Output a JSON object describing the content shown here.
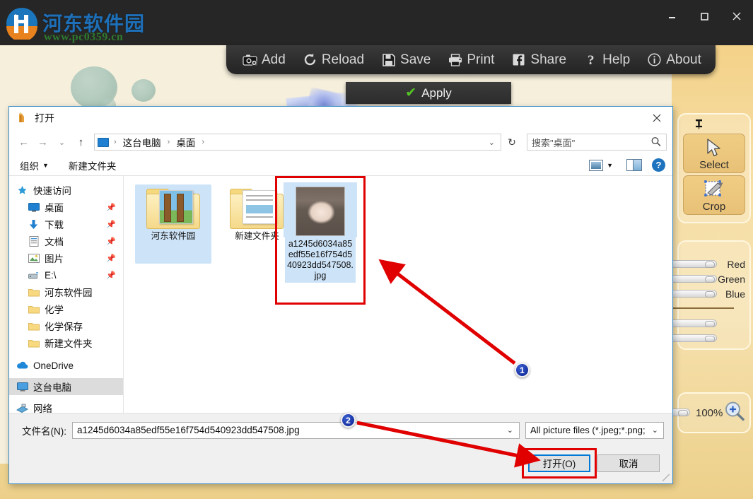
{
  "window": {
    "watermark_title": "河东软件园",
    "watermark_url": "www.pc0359.cn",
    "minimize": "–",
    "maximize": "❐",
    "close": "✕"
  },
  "toolbar": {
    "items": [
      {
        "label": "Add",
        "icon": "camera-add-icon"
      },
      {
        "label": "Reload",
        "icon": "reload-icon"
      },
      {
        "label": "Save",
        "icon": "floppy-save-icon"
      },
      {
        "label": "Print",
        "icon": "printer-icon"
      },
      {
        "label": "Share",
        "icon": "facebook-share-icon"
      },
      {
        "label": "Help",
        "icon": "question-help-icon"
      },
      {
        "label": "About",
        "icon": "info-about-icon"
      }
    ]
  },
  "apply_bar": {
    "label": "Apply",
    "icon": "green-check-icon"
  },
  "right_panel": {
    "pin_icon": "pin-icon",
    "tools": [
      {
        "label": "Select",
        "icon": "cursor-arrow-icon"
      },
      {
        "label": "Crop",
        "icon": "crop-icon"
      }
    ],
    "sliders": [
      {
        "label": "Red"
      },
      {
        "label": "Green"
      },
      {
        "label": "Blue"
      }
    ],
    "zoom": {
      "value": "100%",
      "icon": "magnifier-plus-icon"
    }
  },
  "dialog": {
    "title": "打开",
    "title_icon": "app-icon",
    "close_label": "✕",
    "nav": {
      "back": "←",
      "forward": "→",
      "recent": "⌄",
      "up": "↑",
      "refresh": "↻",
      "breadcrumb": [
        "这台电脑",
        "桌面"
      ],
      "breadcrumb_sep": "›",
      "breadcrumb_caret": "⌄"
    },
    "search": {
      "placeholder": "搜索\"桌面\"",
      "icon": "search-icon"
    },
    "commandbar": {
      "organize": "组织",
      "organize_caret": "▼",
      "new_folder": "新建文件夹",
      "view_icon": "view-layout-icon",
      "view_caret": "▼",
      "preview_icon": "preview-pane-icon",
      "help_icon": "help-icon",
      "help_label": "?"
    },
    "nav_pane": [
      {
        "label": "快速访问",
        "icon": "star-pin-icon",
        "group": true,
        "pinned": false,
        "selected": false
      },
      {
        "label": "桌面",
        "icon": "desktop-icon",
        "indent": true,
        "pinned": true,
        "selected": false
      },
      {
        "label": "下载",
        "icon": "download-icon",
        "indent": true,
        "pinned": true,
        "selected": false
      },
      {
        "label": "文档",
        "icon": "documents-icon",
        "indent": true,
        "pinned": true,
        "selected": false
      },
      {
        "label": "图片",
        "icon": "pictures-icon",
        "indent": true,
        "pinned": true,
        "selected": false
      },
      {
        "label": "E:\\",
        "icon": "drive-icon",
        "indent": true,
        "pinned": true,
        "selected": false
      },
      {
        "label": "河东软件园",
        "icon": "folder-icon",
        "indent": true,
        "pinned": false,
        "selected": false
      },
      {
        "label": "化学",
        "icon": "folder-icon",
        "indent": true,
        "pinned": false,
        "selected": false
      },
      {
        "label": "化学保存",
        "icon": "folder-icon",
        "indent": true,
        "pinned": false,
        "selected": false
      },
      {
        "label": "新建文件夹",
        "icon": "folder-icon",
        "indent": true,
        "pinned": false,
        "selected": false
      },
      {
        "label": "OneDrive",
        "icon": "cloud-icon",
        "group": true,
        "pinned": false,
        "selected": false
      },
      {
        "label": "这台电脑",
        "icon": "computer-icon",
        "group": true,
        "pinned": false,
        "selected": true
      },
      {
        "label": "网络",
        "icon": "network-icon",
        "group": true,
        "pinned": false,
        "selected": false
      }
    ],
    "files": [
      {
        "name": "河东软件园",
        "type": "folder",
        "selected": false
      },
      {
        "name": "新建文件夹",
        "type": "folder",
        "selected": false
      },
      {
        "name": "a1245d6034a85edf55e16f754d540923dd547508.jpg",
        "type": "image",
        "selected": true
      }
    ],
    "filename": {
      "label": "文件名(N):",
      "value": "a1245d6034a85edf55e16f754d540923dd547508.jpg",
      "caret": "⌄"
    },
    "filter": {
      "value": "All picture files (*.jpeg;*.png;",
      "caret": "⌄"
    },
    "buttons": {
      "open": "打开(O)",
      "cancel": "取消"
    }
  },
  "annotations": [
    {
      "number": "1",
      "target": "selected-file-thumbnail"
    },
    {
      "number": "2",
      "target": "open-button"
    }
  ]
}
